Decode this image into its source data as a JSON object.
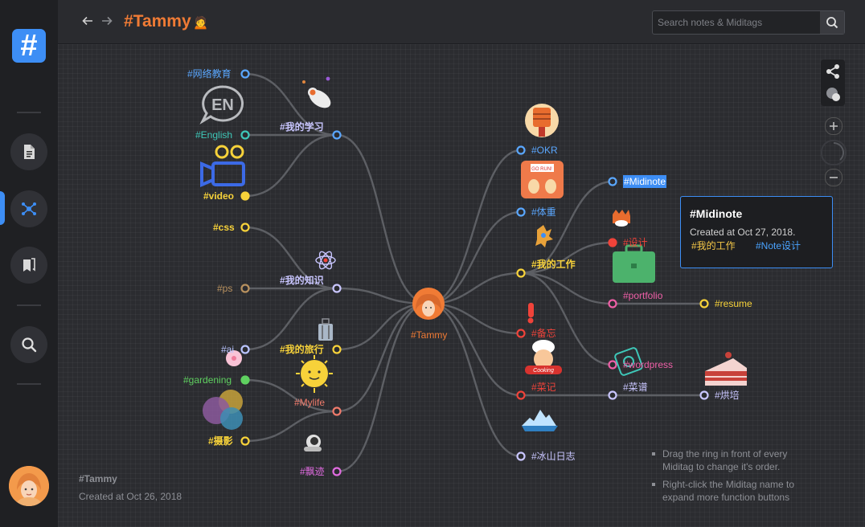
{
  "app": {
    "title": "#Tammy",
    "search_placeholder": "Search notes & Miditags"
  },
  "sidebar": {
    "items": [
      {
        "name": "notes",
        "icon": "document-icon"
      },
      {
        "name": "mindmap",
        "icon": "graph-icon",
        "active": true
      },
      {
        "name": "bookmarks",
        "icon": "bookmark-icon"
      },
      {
        "name": "search",
        "icon": "search-icon"
      }
    ]
  },
  "root": {
    "label": "#Tammy",
    "color": "#f07b35"
  },
  "left_tags": {
    "wangluo": {
      "label": "#网络教育",
      "color": "#5aa7ff"
    },
    "english": {
      "label": "#English",
      "color": "#3ec7b8"
    },
    "video": {
      "label": "#video",
      "color": "#f7d23a"
    },
    "wodexuexi": {
      "label": "#我的学习",
      "color": "#c9c6ff"
    },
    "css": {
      "label": "#css",
      "color": "#f7d23a"
    },
    "ps": {
      "label": "#ps",
      "color": "#b8915f"
    },
    "wodezhishi": {
      "label": "#我的知识",
      "color": "#c9c6ff"
    },
    "ai": {
      "label": "#ai",
      "color": "#b9c4ff"
    },
    "wodelvxing": {
      "label": "#我的旅行",
      "color": "#f7d23a"
    },
    "gardening": {
      "label": "#gardening",
      "color": "#5fd160"
    },
    "mylife": {
      "label": "#Mylife",
      "color": "#f07b6b"
    },
    "sheying": {
      "label": "#摄影",
      "color": "#f7d23a"
    },
    "piaoji": {
      "label": "#飘迹",
      "color": "#e06be0"
    }
  },
  "right_tags": {
    "okr": {
      "label": "#OKR",
      "color": "#5aa7ff"
    },
    "tizhong": {
      "label": "#体重",
      "color": "#5aa7ff"
    },
    "midinote": {
      "label": "#Midinote",
      "color": "#ffffff",
      "bg": "#3d8ef5"
    },
    "sheji": {
      "label": "#设计",
      "color": "#f0433a"
    },
    "wodegongzuo": {
      "label": "#我的工作",
      "color": "#f7d23a"
    },
    "portfolio": {
      "label": "#portfolio",
      "color": "#ef5fa7"
    },
    "resume": {
      "label": "#resume",
      "color": "#f7d23a"
    },
    "beiwang": {
      "label": "#备忘",
      "color": "#f0433a"
    },
    "wordpress": {
      "label": "#wordpress",
      "color": "#ef5fa7"
    },
    "caiji": {
      "label": "#菜记",
      "color": "#f0433a"
    },
    "caipu": {
      "label": "#菜谱",
      "color": "#c9c6ff"
    },
    "hongbei": {
      "label": "#烘培",
      "color": "#c9c6ff"
    },
    "bingshan": {
      "label": "#冰山日志",
      "color": "#c9c6ff"
    }
  },
  "tooltip": {
    "title": "#Midinote",
    "created": "Created at Oct 27, 2018.",
    "tag1": "#我的工作",
    "tag2": "#Note设计"
  },
  "footer": {
    "tag": "#Tammy",
    "created": "Created at Oct 26, 2018"
  },
  "hints": [
    "Drag the ring in front of every Miditag to change it's order.",
    "Right-click the Miditag name to expand more function buttons"
  ],
  "icons": {
    "share": "share-icon",
    "theme": "theme-icon",
    "zoom_in": "zoom-in-icon",
    "zoom_out": "zoom-out-icon"
  }
}
